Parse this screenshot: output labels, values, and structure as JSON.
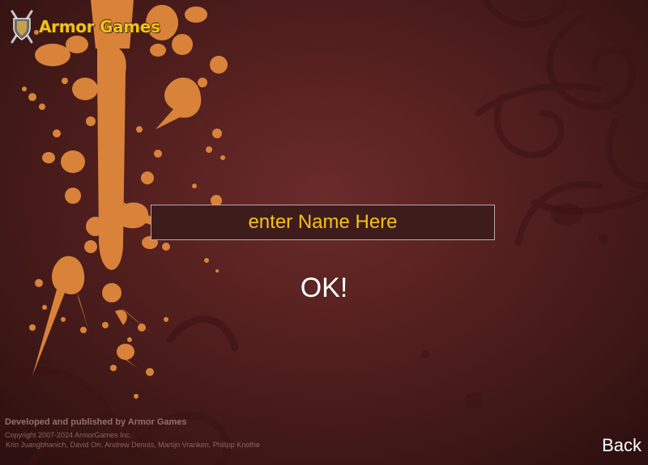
{
  "header": {
    "logo_text": "Armor Games",
    "logo_icon": "shield-swords-icon"
  },
  "name_entry": {
    "placeholder": "enter Name Here",
    "value": ""
  },
  "ok_label": "OK!",
  "back_label": "Back",
  "credits": {
    "developed": "Developed and published by Armor Games",
    "copyright": "Copyright 2007-2024 ArmorGames Inc.",
    "authors": "Krin Juangbhanich, David Orr, Andrew Dennis, Martijn Vranken, Philipp Knothe"
  },
  "colors": {
    "background": "#55201f",
    "splatter": "#d9823a",
    "accent_text": "#f2c21a",
    "input_border": "#b9a9a4"
  }
}
